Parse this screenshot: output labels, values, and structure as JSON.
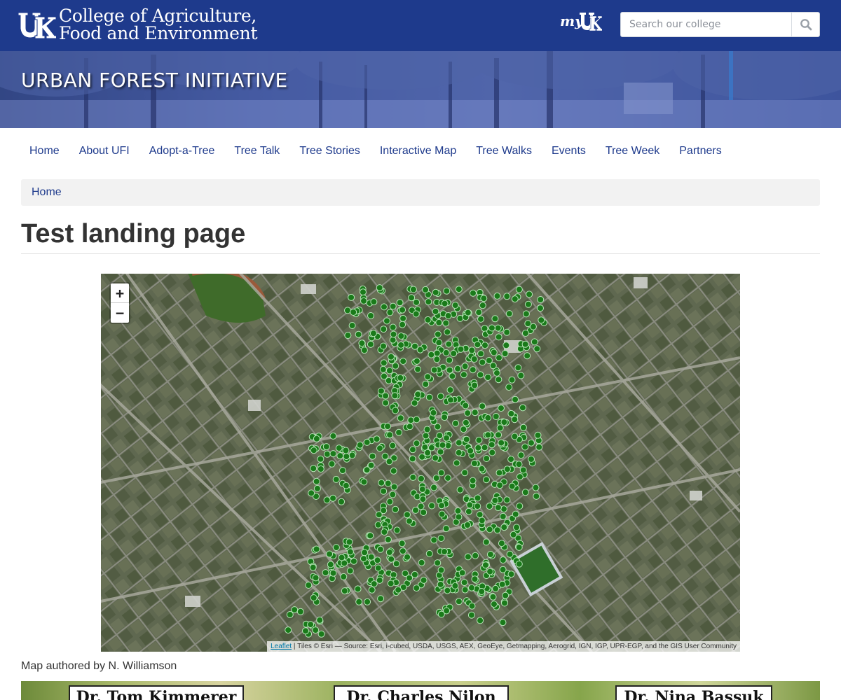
{
  "header": {
    "college_line1": "College of Agriculture,",
    "college_line2": "Food and Environment",
    "myuk_label": "my",
    "search_placeholder": "Search our college"
  },
  "banner": {
    "title": "URBAN FOREST INITIATIVE"
  },
  "nav": {
    "items": [
      {
        "label": "Home"
      },
      {
        "label": "About UFI"
      },
      {
        "label": "Adopt-a-Tree"
      },
      {
        "label": "Tree Talk"
      },
      {
        "label": "Tree Stories"
      },
      {
        "label": "Interactive Map"
      },
      {
        "label": "Tree Walks"
      },
      {
        "label": "Events"
      },
      {
        "label": "Tree Week"
      },
      {
        "label": "Partners"
      }
    ]
  },
  "breadcrumb": {
    "home": "Home"
  },
  "page": {
    "title": "Test landing page"
  },
  "map": {
    "zoom_in": "+",
    "zoom_out": "−",
    "attribution_link": "Leaflet",
    "attribution_text": " | Tiles © Esri — Source: Esri, i-cubed, USDA, USGS, AEX, GeoEye, Getmapping, Aerogrid, IGN, IGP, UPR-EGP, and the GIS User Community",
    "marker_color": "#1a7a1a"
  },
  "caption": "Map authored by N. Williamson",
  "strip": {
    "cards": [
      "Dr. Tom Kimmerer",
      "Dr. Charles Nilon",
      "Dr. Nina Bassuk"
    ]
  },
  "colors": {
    "brand": "#1e3a8c",
    "link": "#1e3a8c"
  }
}
